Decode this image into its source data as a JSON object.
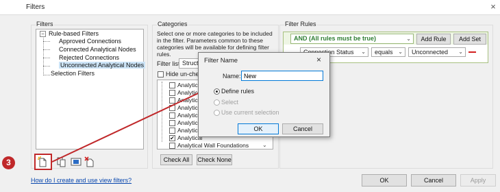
{
  "window": {
    "title": "Filters",
    "close_glyph": "×"
  },
  "filters_panel": {
    "title": "Filters",
    "toggle": "−",
    "tree": {
      "root": "Rule-based Filters",
      "children": [
        "Approved Connections",
        "Connected Analytical Nodes",
        "Rejected Connections",
        "Unconnected Analytical Nodes"
      ],
      "other": "Selection Filters"
    },
    "toolbar_icons": [
      "new-filter-icon",
      "duplicate-filter-icon",
      "rename-filter-icon",
      "delete-filter-icon"
    ]
  },
  "categories_panel": {
    "title": "Categories",
    "description": "Select one or more categories to be included in the filter.  Parameters common to these categories will be available for defining filter rules.",
    "filter_list_label": "Filter list:",
    "filter_list_value": "Structur",
    "hide_unchecked_label": "Hide un-checke",
    "items": [
      {
        "label": "Analytical",
        "checked": false
      },
      {
        "label": "Analytical",
        "checked": false
      },
      {
        "label": "Analytical",
        "checked": false
      },
      {
        "label": "Analytical",
        "checked": false
      },
      {
        "label": "Analytical",
        "checked": false
      },
      {
        "label": "Analytical",
        "checked": false
      },
      {
        "label": "Analytical",
        "checked": false
      },
      {
        "label": "Analytical",
        "checked": true
      },
      {
        "label": "Analytical Wall Foundations",
        "checked": false
      }
    ],
    "check_all": "Check All",
    "check_none": "Check None"
  },
  "rules_panel": {
    "title": "Filter Rules",
    "logic": "AND (All rules must be true)",
    "add_rule": "Add Rule",
    "add_set": "Add Set",
    "rule": {
      "parameter": "Connection Status",
      "operator": "equals",
      "value": "Unconnected"
    }
  },
  "dialog": {
    "title": "Filter Name",
    "name_label": "Name:",
    "name_value": "New",
    "options": [
      "Define rules",
      "Select",
      "Use current selection"
    ],
    "selected_option": "Define rules",
    "ok": "OK",
    "cancel": "Cancel"
  },
  "footer": {
    "help_link": "How do I create and use view filters?",
    "ok": "OK",
    "cancel": "Cancel",
    "apply": "Apply"
  },
  "callout": {
    "number": "3",
    "color": "#c0282a"
  }
}
